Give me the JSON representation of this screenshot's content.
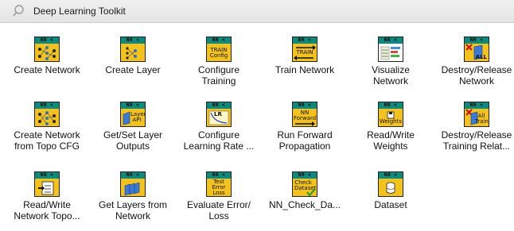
{
  "palette": {
    "title": "Deep Learning Toolkit",
    "pin_icon": "pin-icon"
  },
  "items": [
    {
      "line1": "Create Network",
      "line2": "",
      "icon_text": "",
      "icon": "network-nodes-icon"
    },
    {
      "line1": "Create Layer",
      "line2": "",
      "icon_text": "",
      "icon": "layer-nodes-icon"
    },
    {
      "line1": "Configure",
      "line2": "Training",
      "icon_text": "TRAIN Config",
      "icon": "train-config-icon"
    },
    {
      "line1": "Train Network",
      "line2": "",
      "icon_text": "TRAIN",
      "icon": "train-network-icon"
    },
    {
      "line1": "Visualize",
      "line2": "Network",
      "icon_text": "",
      "icon": "visualize-icon"
    },
    {
      "line1": "Destroy/Release",
      "line2": "Network",
      "icon_text": "ALL",
      "icon": "destroy-network-icon"
    },
    {
      "line1": "Create Network",
      "line2": "from Topo CFG",
      "icon_text": "",
      "icon": "network-from-topo-icon"
    },
    {
      "line1": "Get/Set Layer",
      "line2": "Outputs",
      "icon_text": "Layer API",
      "icon": "layer-api-icon"
    },
    {
      "line1": "Configure",
      "line2": "Learning Rate ...",
      "icon_text": "LR",
      "icon": "learning-rate-icon"
    },
    {
      "line1": "Run Forward",
      "line2": "Propagation",
      "icon_text": "NN Forward",
      "icon": "forward-icon"
    },
    {
      "line1": "Read/Write",
      "line2": "Weights",
      "icon_text": "Weights",
      "icon": "weights-icon"
    },
    {
      "line1": "Destroy/Release",
      "line2": "Training Relat...",
      "icon_text": "All Train",
      "icon": "destroy-training-icon"
    },
    {
      "line1": "Read/Write",
      "line2": "Network Topo...",
      "icon_text": "",
      "icon": "topology-file-icon"
    },
    {
      "line1": "Get Layers from",
      "line2": "Network",
      "icon_text": "",
      "icon": "get-layers-icon"
    },
    {
      "line1": "Evaluate Error/",
      "line2": "Loss",
      "icon_text": "Test Error Loss",
      "icon": "error-loss-icon"
    },
    {
      "line1": "NN_Check_Da...",
      "line2": "",
      "icon_text": "Check Dataset",
      "icon": "check-dataset-icon"
    },
    {
      "line1": "Dataset",
      "line2": "",
      "icon_text": "",
      "icon": "dataset-icon"
    }
  ]
}
